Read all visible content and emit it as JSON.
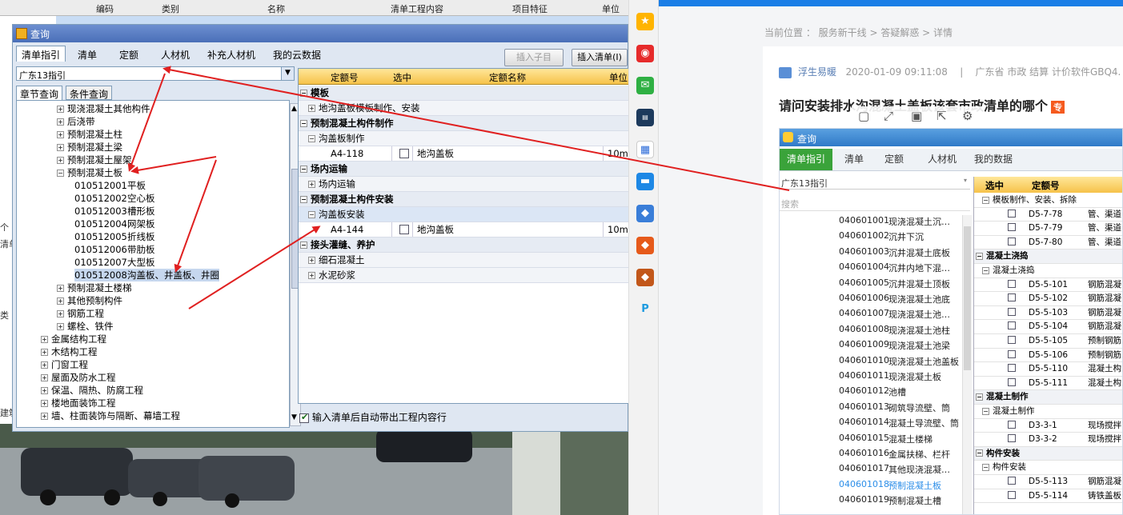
{
  "background_sheet": {
    "headers": [
      "编码",
      "类别",
      "名称",
      "清单工程内容",
      "项目特征",
      "单位"
    ],
    "side_snippets": [
      "个",
      "清单",
      "类",
      "建筑"
    ]
  },
  "dialog": {
    "title": "查询",
    "tabs": [
      "清单指引",
      "清单",
      "定额",
      "人材机",
      "补充人材机",
      "我的云数据"
    ],
    "insert_child_btn": "插入子目",
    "insert_list_btn": "插入清单(I)",
    "region_select": "广东13指引",
    "subtabs": [
      "章节查询",
      "条件查询"
    ],
    "tree": [
      {
        "label": "现浇混凝土其他构件",
        "level": 3,
        "type": "plus"
      },
      {
        "label": "后浇带",
        "level": 3,
        "type": "plus"
      },
      {
        "label": "预制混凝土柱",
        "level": 3,
        "type": "plus"
      },
      {
        "label": "预制混凝土梁",
        "level": 3,
        "type": "plus"
      },
      {
        "label": "预制混凝土屋架",
        "level": 3,
        "type": "plus"
      },
      {
        "label": "预制混凝土板",
        "level": 3,
        "type": "minus"
      },
      {
        "code": "010512001",
        "label": "平板",
        "level": 4
      },
      {
        "code": "010512002",
        "label": "空心板",
        "level": 4
      },
      {
        "code": "010512003",
        "label": "槽形板",
        "level": 4
      },
      {
        "code": "010512004",
        "label": "网架板",
        "level": 4
      },
      {
        "code": "010512005",
        "label": "折线板",
        "level": 4
      },
      {
        "code": "010512006",
        "label": "带肋板",
        "level": 4
      },
      {
        "code": "010512007",
        "label": "大型板",
        "level": 4
      },
      {
        "code": "010512008",
        "label": "沟盖板、井盖板、井圈",
        "level": 4,
        "selected": true
      },
      {
        "label": "预制混凝土楼梯",
        "level": 3,
        "type": "plus"
      },
      {
        "label": "其他预制构件",
        "level": 3,
        "type": "plus"
      },
      {
        "label": "钢筋工程",
        "level": 3,
        "type": "plus"
      },
      {
        "label": "螺栓、铁件",
        "level": 3,
        "type": "plus"
      },
      {
        "label": "金属结构工程",
        "level": 2,
        "type": "plus"
      },
      {
        "label": "木结构工程",
        "level": 2,
        "type": "plus"
      },
      {
        "label": "门窗工程",
        "level": 2,
        "type": "plus"
      },
      {
        "label": "屋面及防水工程",
        "level": 2,
        "type": "plus"
      },
      {
        "label": "保温、隔热、防腐工程",
        "level": 2,
        "type": "plus"
      },
      {
        "label": "楼地面装饰工程",
        "level": 2,
        "type": "plus"
      },
      {
        "label": "墙、柱面装饰与隔断、幕墙工程",
        "level": 2,
        "type": "plus"
      }
    ],
    "grid_headers": [
      "定额号",
      "选中",
      "定额名称",
      "单位"
    ],
    "grid_rows": [
      {
        "kind": "group",
        "label": "模板"
      },
      {
        "kind": "sub",
        "label": "地沟盖板模板制作、安装",
        "sign": "+"
      },
      {
        "kind": "group",
        "label": "预制混凝土构件制作"
      },
      {
        "kind": "sub",
        "label": "沟盖板制作",
        "sign": "−"
      },
      {
        "kind": "item",
        "code": "A4-118",
        "name": "地沟盖板",
        "unit": "10m3"
      },
      {
        "kind": "group",
        "label": "场内运输"
      },
      {
        "kind": "sub",
        "label": "场内运输",
        "sign": "+"
      },
      {
        "kind": "group",
        "label": "预制混凝土构件安装"
      },
      {
        "kind": "sub",
        "label": "沟盖板安装",
        "sign": "−",
        "selected": true
      },
      {
        "kind": "item",
        "code": "A4-144",
        "name": "地沟盖板",
        "unit": "10m3"
      },
      {
        "kind": "group",
        "label": "接头灌缝、养护"
      },
      {
        "kind": "sub",
        "label": "细石混凝土",
        "sign": "+"
      },
      {
        "kind": "sub",
        "label": "水泥砂浆",
        "sign": "+"
      }
    ],
    "auto_check_label": "输入清单后自动带出工程内容行"
  },
  "web": {
    "breadcrumb": "当前位置 ： 服务新干线 > 答疑解惑 > 详情",
    "author": "浮生易暖",
    "datetime": "2020-01-09 09:11:08",
    "sep": "|",
    "tags": "广东省  市政 结算 计价软件GBQ4.",
    "question_title": "请问安装排水沟混凝土盖板该套市政清单的哪个",
    "badge": "专",
    "embedded": {
      "title": "查询",
      "tabs": [
        "清单指引",
        "清单",
        "定额",
        "人材机",
        "我的数据"
      ],
      "region": "广东13指引",
      "search_placeholder": "搜索",
      "list": [
        {
          "code": "040601001",
          "name": "现浇混凝土沉…"
        },
        {
          "code": "040601002",
          "name": "沉井下沉"
        },
        {
          "code": "040601003",
          "name": "沉井混凝土底板"
        },
        {
          "code": "040601004",
          "name": "沉井内地下混…"
        },
        {
          "code": "040601005",
          "name": "沉井混凝土顶板"
        },
        {
          "code": "040601006",
          "name": "现浇混凝土池底"
        },
        {
          "code": "040601007",
          "name": "现浇混凝土池…"
        },
        {
          "code": "040601008",
          "name": "现浇混凝土池柱"
        },
        {
          "code": "040601009",
          "name": "现浇混凝土池梁"
        },
        {
          "code": "040601010",
          "name": "现浇混凝土池盖板"
        },
        {
          "code": "040601011",
          "name": "现浇混凝土板"
        },
        {
          "code": "040601012",
          "name": "池槽"
        },
        {
          "code": "040601013",
          "name": "砌筑导流壁、筒"
        },
        {
          "code": "040601014",
          "name": "混凝土导流壁、筒"
        },
        {
          "code": "040601015",
          "name": "混凝土楼梯"
        },
        {
          "code": "040601016",
          "name": "金属扶梯、栏杆"
        },
        {
          "code": "040601017",
          "name": "其他现浇混凝…"
        },
        {
          "code": "040601018",
          "name": "预制混凝土板",
          "highlight": true
        },
        {
          "code": "040601019",
          "name": "预制混凝土槽"
        }
      ],
      "grid_headers": [
        "选中",
        "定额号"
      ],
      "grid_rows": [
        {
          "kind": "sub",
          "label": "模板制作、安装、拆除"
        },
        {
          "kind": "item",
          "code": "D5-7-78",
          "name": "管、渠道"
        },
        {
          "kind": "item",
          "code": "D5-7-79",
          "name": "管、渠道"
        },
        {
          "kind": "item",
          "code": "D5-7-80",
          "name": "管、渠道"
        },
        {
          "kind": "group",
          "label": "混凝土浇捣"
        },
        {
          "kind": "sub",
          "label": "混凝土浇捣"
        },
        {
          "kind": "item",
          "code": "D5-5-101",
          "name": "钢筋混凝"
        },
        {
          "kind": "item",
          "code": "D5-5-102",
          "name": "钢筋混凝"
        },
        {
          "kind": "item",
          "code": "D5-5-103",
          "name": "钢筋混凝内"
        },
        {
          "kind": "item",
          "code": "D5-5-104",
          "name": "钢筋混凝"
        },
        {
          "kind": "item",
          "code": "D5-5-105",
          "name": "预制钢筋"
        },
        {
          "kind": "item",
          "code": "D5-5-106",
          "name": "预制钢筋"
        },
        {
          "kind": "item",
          "code": "D5-5-110",
          "name": "混凝土构"
        },
        {
          "kind": "item",
          "code": "D5-5-111",
          "name": "混凝土构"
        },
        {
          "kind": "group",
          "label": "混凝土制作"
        },
        {
          "kind": "sub",
          "label": "混凝土制作"
        },
        {
          "kind": "item",
          "code": "D3-3-1",
          "name": "现场搅拌"
        },
        {
          "kind": "item",
          "code": "D3-3-2",
          "name": "现场搅拌"
        },
        {
          "kind": "group",
          "label": "构件安装"
        },
        {
          "kind": "sub",
          "label": "构件安装"
        },
        {
          "kind": "item",
          "code": "D5-5-113",
          "name": "钢筋混凝"
        },
        {
          "kind": "item",
          "code": "D5-5-114",
          "name": "铸铁盖板"
        }
      ]
    }
  },
  "colors": {
    "accent_red": "#e02020",
    "title_blue": "#4a6fb8",
    "header_gold": "#f6c24a",
    "green_tab": "#3aa33a"
  },
  "sidebar_icons": [
    "star-icon",
    "weibo-icon",
    "mail-icon",
    "news-icon",
    "doc-icon",
    "chat-icon",
    "game-icon-1",
    "game-icon-2",
    "game-icon-3",
    "p-icon"
  ]
}
